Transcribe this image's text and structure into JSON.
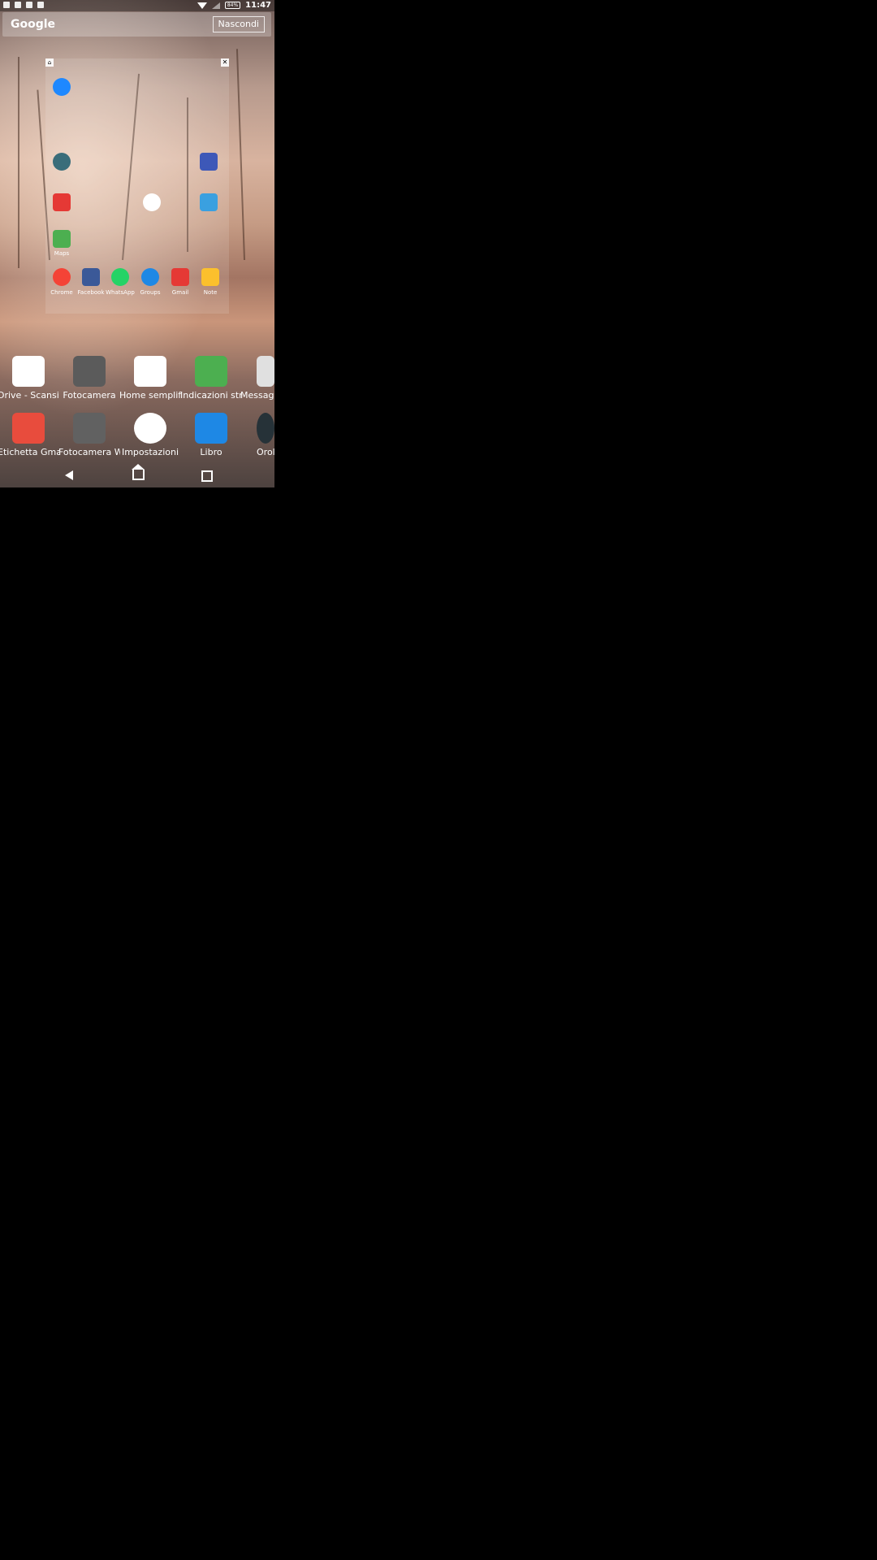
{
  "statusbar": {
    "battery": "84%",
    "time": "11:47"
  },
  "search": {
    "logo": "Google",
    "hide_button": "Nascondi"
  },
  "folder": {
    "home_icon": "home-icon",
    "close_icon": "close-icon",
    "apps": [
      {
        "label": "",
        "icon": "messenger-icon",
        "color": "#1e88ff"
      },
      {
        "label": "",
        "icon": "space-icon",
        "color": "#4a6fd8"
      },
      {
        "label": "",
        "icon": "radar-icon",
        "color": "#3a6d7a"
      },
      {
        "label": "",
        "icon": "youtube-icon",
        "color": "#e53935"
      },
      {
        "label": "",
        "icon": "settings-icon",
        "color": "#ffffff"
      },
      {
        "label": "",
        "icon": "calendar-icon",
        "color": "#3aa0e0"
      },
      {
        "label": "Maps",
        "icon": "maps-icon",
        "color": "#4caf50"
      },
      {
        "label": "Chrome",
        "icon": "chrome-icon",
        "color": "#f44336"
      },
      {
        "label": "Facebook",
        "icon": "facebook-icon",
        "color": "#3b5998"
      },
      {
        "label": "WhatsApp",
        "icon": "whatsapp-icon",
        "color": "#25d366"
      },
      {
        "label": "Groups",
        "icon": "groups-icon",
        "color": "#1e88e5"
      },
      {
        "label": "Gmail",
        "icon": "gmail-icon",
        "color": "#e53935"
      },
      {
        "label": "Note",
        "icon": "note-icon",
        "color": "#fbc02d"
      }
    ]
  },
  "dock": {
    "row1": [
      {
        "label": "Drive - Scansione",
        "icon": "drive-scan-icon",
        "color": "#ffffff"
      },
      {
        "label": "Fotocamera",
        "icon": "camera-icon",
        "color": "#5b5b5b"
      },
      {
        "label": "Home semplific",
        "icon": "simple-home-icon",
        "color": "#ffffff"
      },
      {
        "label": "Indicazioni strad",
        "icon": "directions-icon",
        "color": "#4caf50"
      },
      {
        "label": "Messagg",
        "icon": "messages-icon",
        "color": "#e0e0e0"
      }
    ],
    "row2": [
      {
        "label": "Etichetta Gmail",
        "icon": "gmail-label-icon",
        "color": "#e84c3d"
      },
      {
        "label": "Fotocamera Wh",
        "icon": "whatsapp-camera-icon",
        "color": "#616161"
      },
      {
        "label": "Impostazioni",
        "icon": "settings-icon",
        "color": "#ffffff"
      },
      {
        "label": "Libro",
        "icon": "book-icon",
        "color": "#1e88e5"
      },
      {
        "label": "Orolo",
        "icon": "clock-icon",
        "color": "#263238"
      }
    ]
  },
  "navbar": {
    "back": "back-icon",
    "home": "home-icon",
    "recents": "recents-icon"
  }
}
